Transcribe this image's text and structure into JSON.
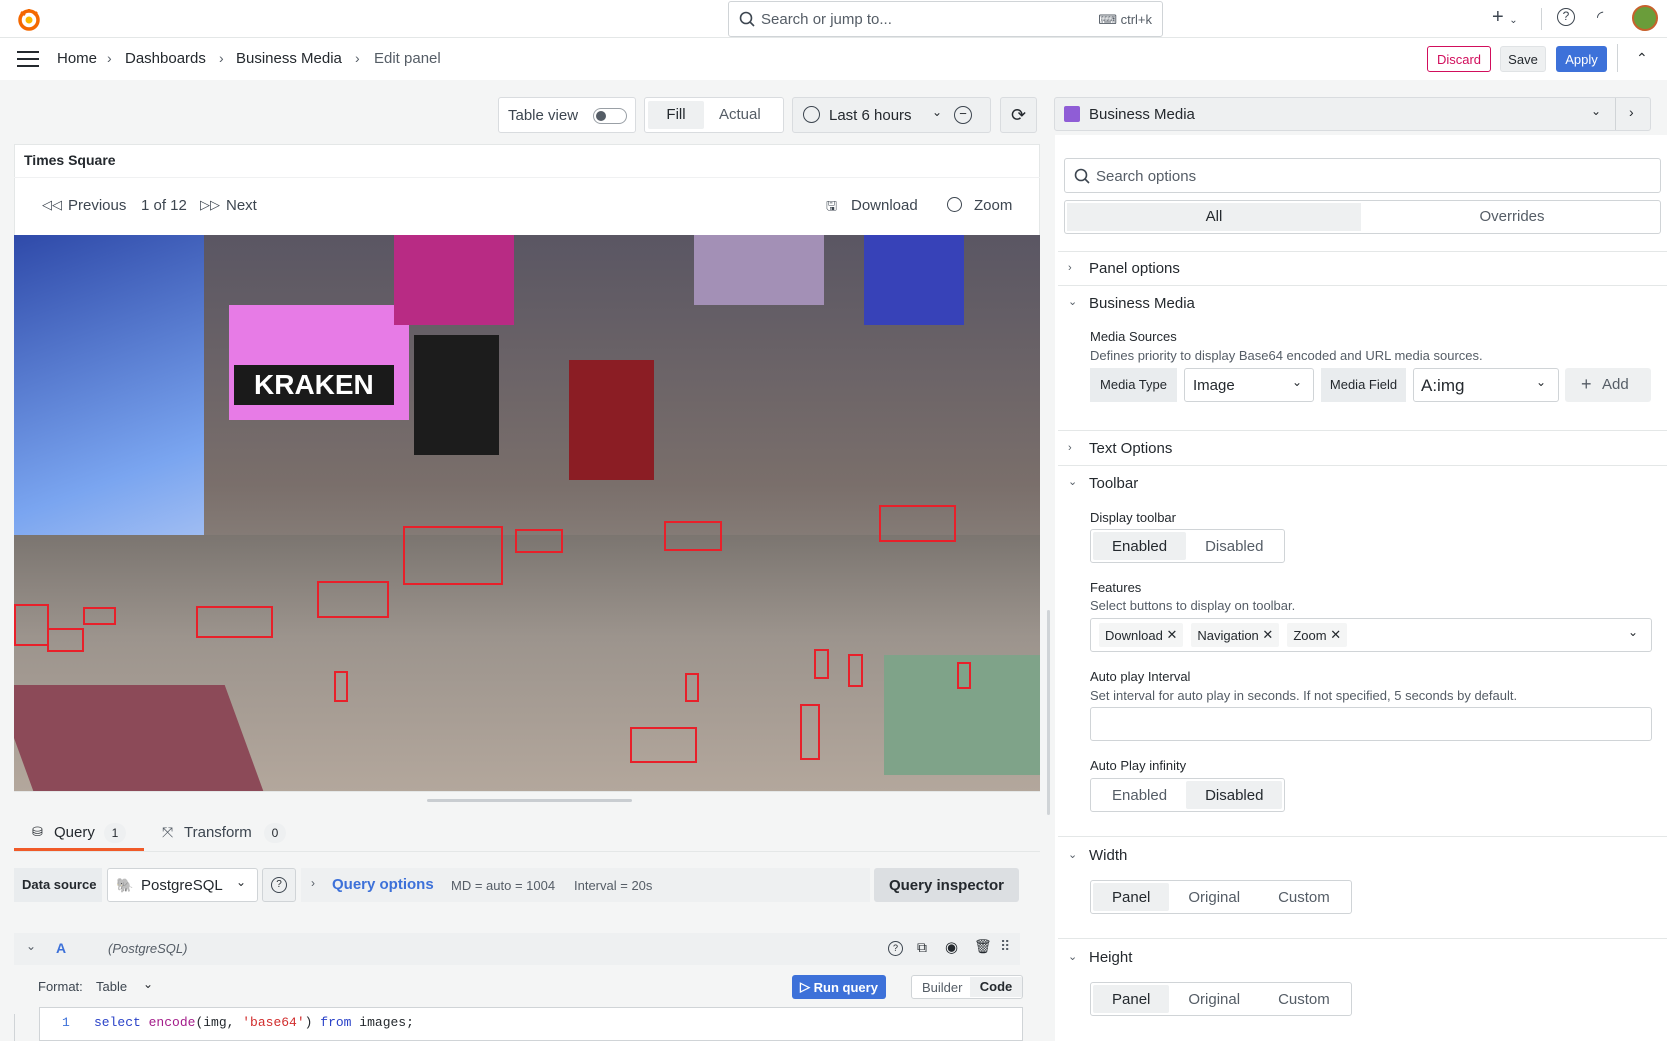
{
  "search": {
    "placeholder": "Search or jump to...",
    "shortcut": "ctrl+k"
  },
  "breadcrumb": [
    "Home",
    "Dashboards",
    "Business Media",
    "Edit panel"
  ],
  "actions": {
    "discard": "Discard",
    "save": "Save",
    "apply": "Apply"
  },
  "viewbar": {
    "table_view": "Table view",
    "fill": "Fill",
    "actual": "Actual",
    "time": "Last 6 hours"
  },
  "panel": {
    "title": "Times Square",
    "previous": "Previous",
    "counter": "1 of 12",
    "next": "Next",
    "download": "Download",
    "zoom": "Zoom"
  },
  "query_tabs": {
    "query": "Query",
    "query_count": "1",
    "transform": "Transform",
    "transform_count": "0"
  },
  "query_row": {
    "data_source_label": "Data source",
    "data_source": "PostgreSQL",
    "query_options": "Query options",
    "md": "MD = auto = 1004",
    "interval": "Interval = 20s",
    "inspector": "Query inspector"
  },
  "query_a": {
    "letter": "A",
    "ds": "(PostgreSQL)",
    "format_label": "Format:",
    "format": "Table",
    "run": "Run query",
    "builder": "Builder",
    "code": "Code",
    "line_no": "1"
  },
  "viz_picker": {
    "name": "Business Media"
  },
  "options": {
    "search_placeholder": "Search options",
    "all": "All",
    "overrides": "Overrides",
    "panel_options": "Panel options",
    "business_media": "Business Media",
    "media_sources": "Media Sources",
    "media_sources_desc": "Defines priority to display Base64 encoded and URL media sources.",
    "media_type_label": "Media Type",
    "media_type": "Image",
    "media_field_label": "Media Field",
    "media_field": "A:img",
    "add": "Add",
    "text_options": "Text Options",
    "toolbar": "Toolbar",
    "display_toolbar": "Display toolbar",
    "enabled": "Enabled",
    "disabled": "Disabled",
    "features": "Features",
    "features_desc": "Select buttons to display on toolbar.",
    "feature_tags": [
      "Download",
      "Navigation",
      "Zoom"
    ],
    "auto_play": "Auto play Interval",
    "auto_play_desc": "Set interval for auto play in seconds. If not specified, 5 seconds by default.",
    "auto_play_inf": "Auto Play infinity",
    "width": "Width",
    "height": "Height",
    "panel": "Panel",
    "original": "Original",
    "custom": "Custom"
  },
  "colors": {
    "accent": "#3d71d9",
    "discard": "#d10e5c",
    "tab_underline": "#f05a28",
    "bbox": "#e8202a"
  }
}
